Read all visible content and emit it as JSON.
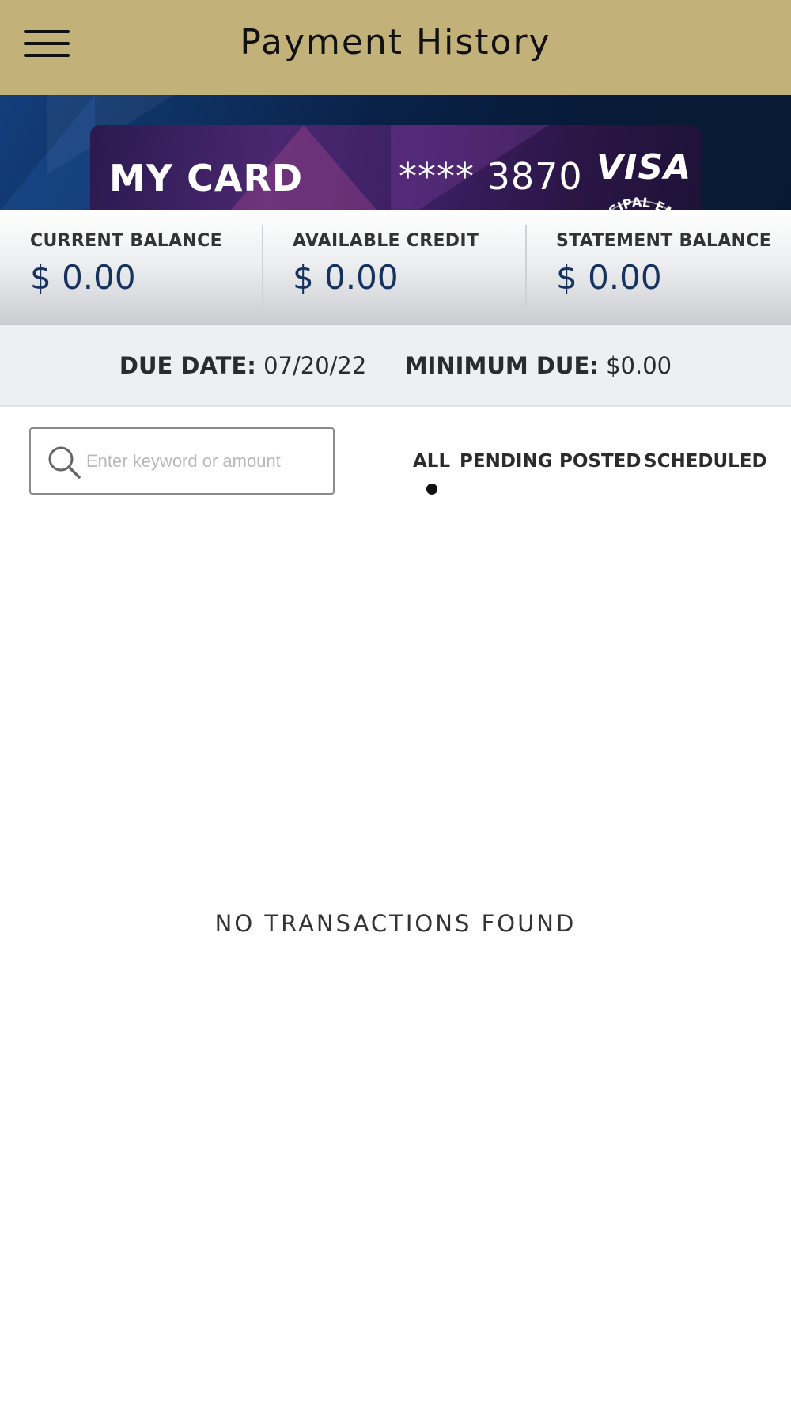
{
  "header": {
    "title": "Payment History",
    "menu_icon": "hamburger-menu-icon"
  },
  "card": {
    "name": "MY CARD",
    "number_masked": "**** 3870",
    "network": "VISA",
    "seal_text": "MUNICIPAL EM"
  },
  "balances": [
    {
      "label": "CURRENT BALANCE",
      "value": "$ 0.00"
    },
    {
      "label": "AVAILABLE CREDIT",
      "value": "$ 0.00"
    },
    {
      "label": "STATEMENT BALANCE",
      "value": "$ 0.00"
    }
  ],
  "due": {
    "due_date_label": "DUE DATE:",
    "due_date_value": "07/20/22",
    "minimum_due_label": "MINIMUM DUE:",
    "minimum_due_value": "$0.00"
  },
  "search": {
    "placeholder": "Enter keyword or amount",
    "value": ""
  },
  "filters": {
    "items": [
      "ALL",
      "PENDING",
      "POSTED",
      "SCHEDULED"
    ],
    "active": "ALL"
  },
  "empty_state": "NO TRANSACTIONS FOUND",
  "colors": {
    "header_bg": "#c3b17a",
    "balance_value": "#17325e",
    "banner_bg": "#0a2248"
  }
}
